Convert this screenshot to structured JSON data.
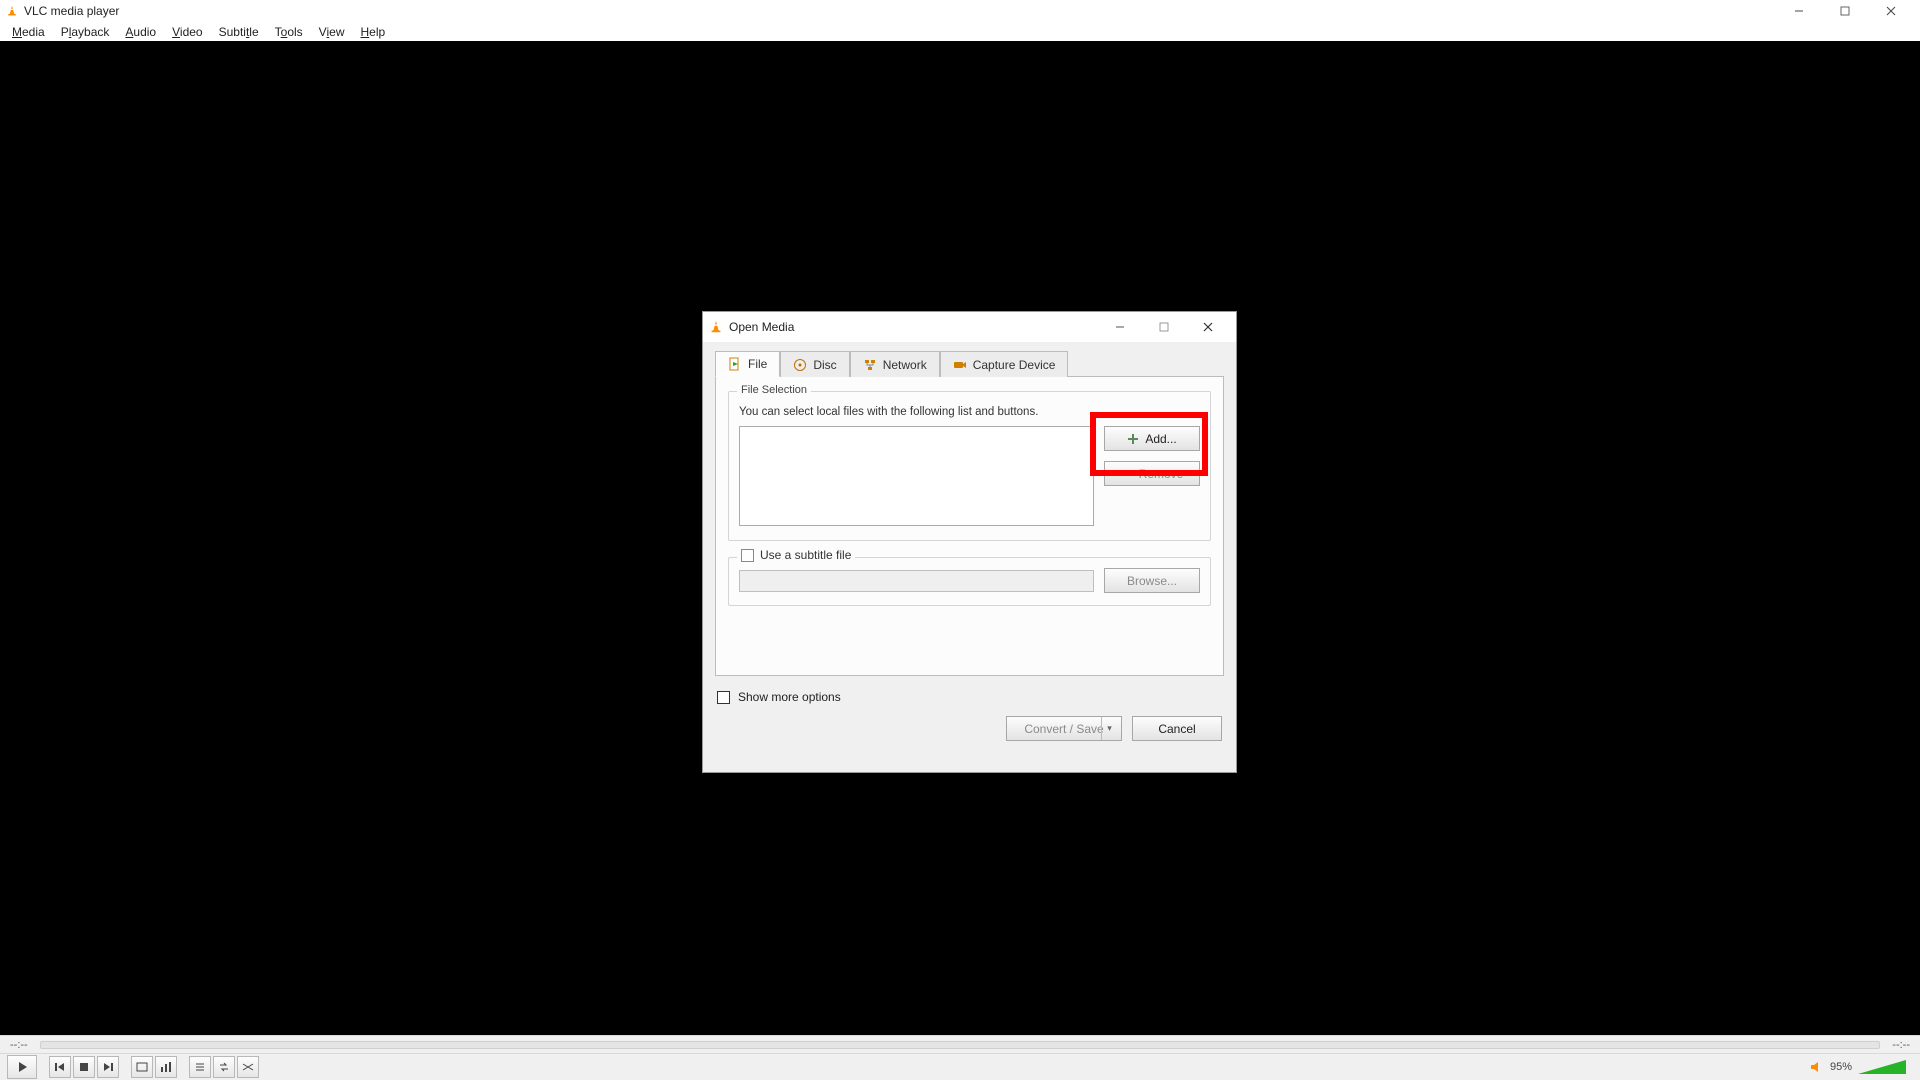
{
  "window": {
    "title": "VLC media player",
    "menus": [
      "Media",
      "Playback",
      "Audio",
      "Video",
      "Subtitle",
      "Tools",
      "View",
      "Help"
    ]
  },
  "seek": {
    "time_left": "--:--",
    "time_right": "--:--"
  },
  "volume": {
    "percent": "95%"
  },
  "controls": {
    "play": "play",
    "prev": "previous",
    "stop": "stop",
    "next": "next",
    "fullscreen": "fullscreen",
    "ext": "extended-settings",
    "playlist": "playlist",
    "loop": "loop",
    "random": "random"
  },
  "dialog": {
    "title": "Open Media",
    "tabs": {
      "file": "File",
      "disc": "Disc",
      "network": "Network",
      "capture": "Capture Device"
    },
    "file_section": {
      "legend": "File Selection",
      "hint": "You can select local files with the following list and buttons.",
      "add": "Add...",
      "remove": "Remove"
    },
    "subtitle": {
      "checkbox": "Use a subtitle file",
      "browse": "Browse..."
    },
    "show_more": "Show more options",
    "convert": "Convert / Save",
    "cancel": "Cancel"
  }
}
